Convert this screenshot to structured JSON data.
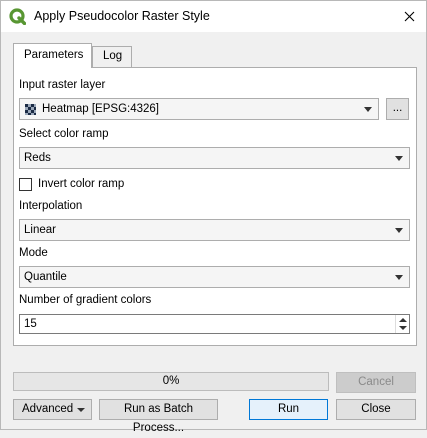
{
  "window": {
    "title": "Apply Pseudocolor Raster Style"
  },
  "tabs": [
    {
      "label": "Parameters"
    },
    {
      "label": "Log"
    }
  ],
  "form": {
    "input_raster_label": "Input raster layer",
    "input_raster_value": "Heatmap [EPSG:4326]",
    "browse_label": "...",
    "color_ramp_label": "Select color ramp",
    "color_ramp_value": "Reds",
    "invert_label": "Invert color ramp",
    "invert_checked": false,
    "interpolation_label": "Interpolation",
    "interpolation_value": "Linear",
    "mode_label": "Mode",
    "mode_value": "Quantile",
    "gradient_label": "Number of gradient colors",
    "gradient_value": "15"
  },
  "footer": {
    "progress_text": "0%",
    "progress_fraction": 0,
    "cancel_label": "Cancel",
    "advanced_label": "Advanced",
    "batch_label": "Run as Batch Process...",
    "run_label": "Run",
    "close_label": "Close"
  },
  "colors": {
    "accent": "#0078d7",
    "app_icon": "#589632"
  }
}
